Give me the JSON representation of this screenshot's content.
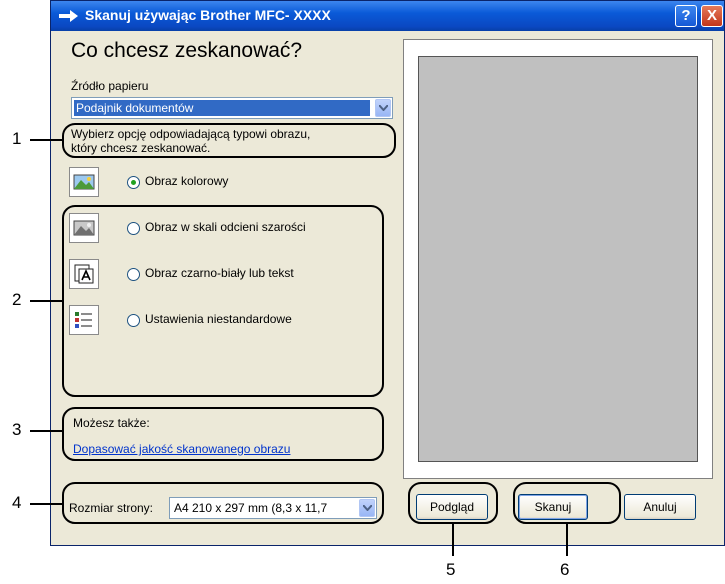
{
  "window": {
    "title": "Skanuj używając Brother MFC- XXXX",
    "help_label": "?",
    "close_label": "X"
  },
  "left": {
    "heading": "Co chcesz zeskanować?",
    "source_label": "Źródło papieru",
    "source_value": "Podajnik dokumentów",
    "instruction_line1": "Wybierz opcję odpowiadającą typowi obrazu,",
    "instruction_line2": "który chcesz zeskanować.",
    "options": [
      {
        "label": "Obraz kolorowy",
        "checked": true,
        "icon": "color-picture-icon"
      },
      {
        "label": "Obraz w skali odcieni szarości",
        "checked": false,
        "icon": "grayscale-picture-icon"
      },
      {
        "label": "Obraz czarno-biały lub tekst",
        "checked": false,
        "icon": "bw-text-icon"
      },
      {
        "label": "Ustawienia niestandardowe",
        "checked": false,
        "icon": "custom-settings-icon"
      }
    ],
    "also_label": "Możesz także:",
    "adjust_link": "Dopasować jakość skanowanego obrazu",
    "page_size_label": "Rozmiar strony:",
    "page_size_value": "A4 210 x 297 mm (8,3 x 11,7"
  },
  "buttons": {
    "preview": "Podgląd",
    "scan": "Skanuj",
    "cancel": "Anuluj"
  },
  "callouts": [
    "1",
    "2",
    "3",
    "4",
    "5",
    "6"
  ],
  "colors": {
    "titlebar": "#0a5ad8",
    "dialog_bg": "#ece9d8",
    "selection": "#316ac5",
    "link": "#0033cc",
    "preview_page": "#c0c0c0"
  }
}
